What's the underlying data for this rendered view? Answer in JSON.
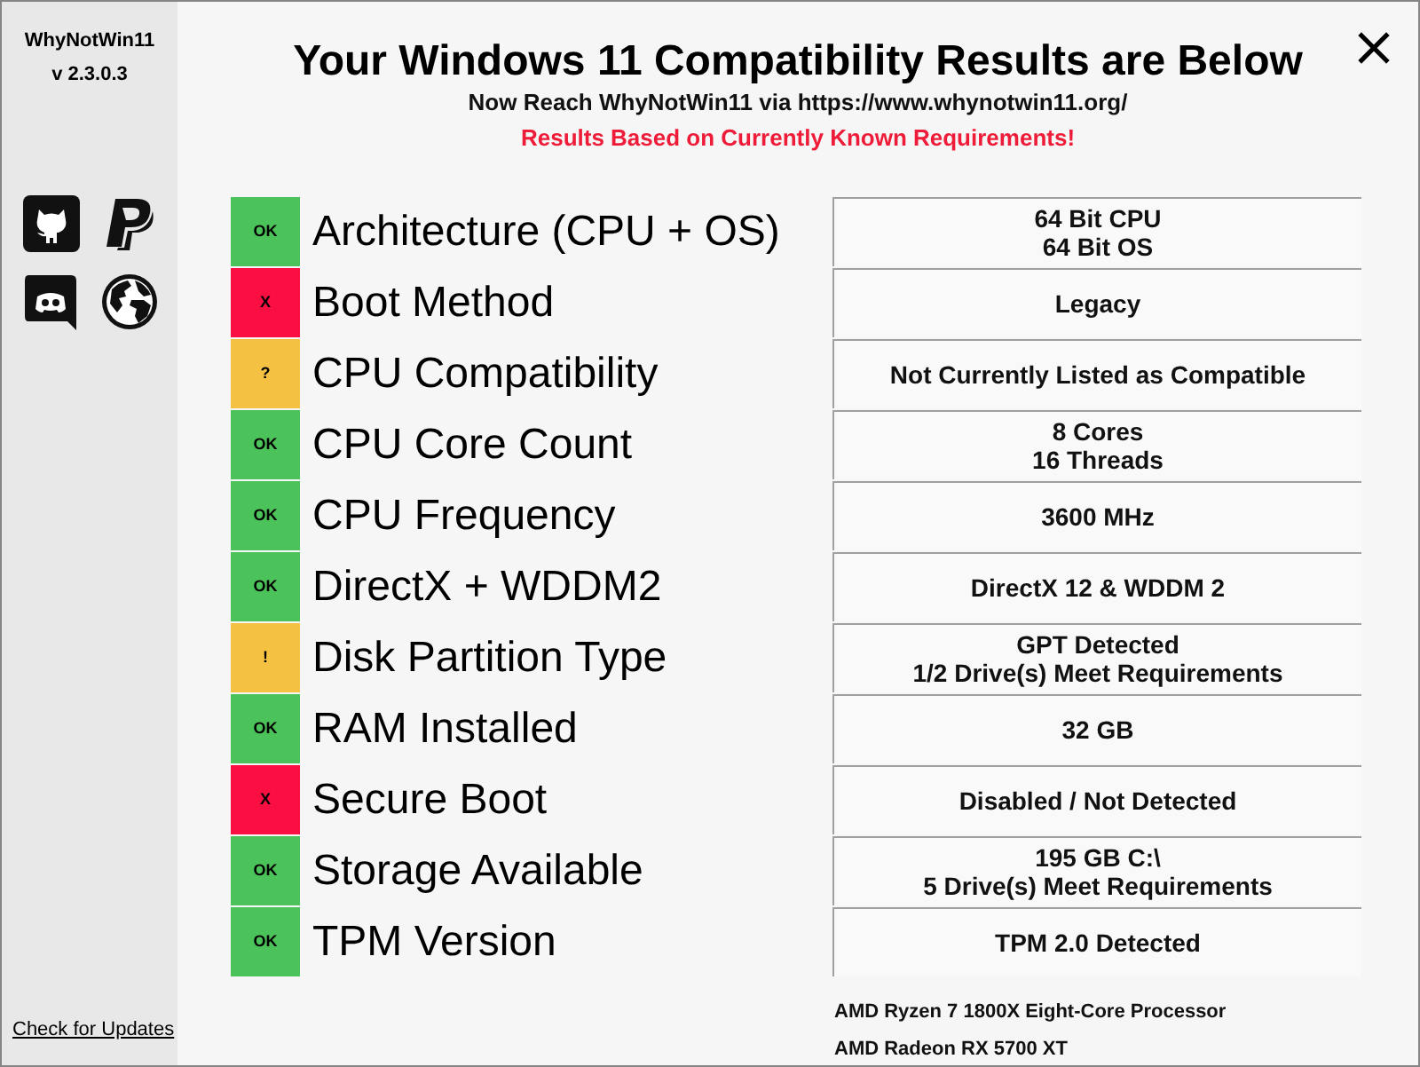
{
  "sidebar": {
    "app_name": "WhyNotWin11",
    "version": "v 2.3.0.3",
    "update_link": "Check for Updates"
  },
  "header": {
    "title": "Your Windows 11 Compatibility Results are Below",
    "subtitle": "Now Reach WhyNotWin11 via https://www.whynotwin11.org/",
    "notice": "Results Based on Currently Known Requirements!"
  },
  "results": [
    {
      "color": "#4cc25a",
      "badge": "OK",
      "label": "Architecture (CPU + OS)",
      "value": "64 Bit CPU\n64 Bit OS"
    },
    {
      "color": "#fb0f43",
      "badge": "X",
      "label": "Boot Method",
      "value": "Legacy"
    },
    {
      "color": "#f4c142",
      "badge": "?",
      "label": "CPU Compatibility",
      "value": "Not Currently Listed as Compatible"
    },
    {
      "color": "#4cc25a",
      "badge": "OK",
      "label": "CPU Core Count",
      "value": "8 Cores\n16 Threads"
    },
    {
      "color": "#4cc25a",
      "badge": "OK",
      "label": "CPU Frequency",
      "value": "3600 MHz"
    },
    {
      "color": "#4cc25a",
      "badge": "OK",
      "label": "DirectX + WDDM2",
      "value": "DirectX 12 & WDDM 2"
    },
    {
      "color": "#f4c142",
      "badge": "!",
      "label": "Disk Partition Type",
      "value": "GPT Detected\n1/2 Drive(s) Meet Requirements"
    },
    {
      "color": "#4cc25a",
      "badge": "OK",
      "label": "RAM Installed",
      "value": "32 GB"
    },
    {
      "color": "#fb0f43",
      "badge": "X",
      "label": "Secure Boot",
      "value": "Disabled / Not Detected"
    },
    {
      "color": "#4cc25a",
      "badge": "OK",
      "label": "Storage Available",
      "value": "195 GB C:\\\n5 Drive(s) Meet Requirements"
    },
    {
      "color": "#4cc25a",
      "badge": "OK",
      "label": "TPM Version",
      "value": "TPM 2.0 Detected"
    }
  ],
  "hardware": [
    "AMD Ryzen 7 1800X Eight-Core Processor",
    "AMD Radeon RX 5700 XT"
  ]
}
